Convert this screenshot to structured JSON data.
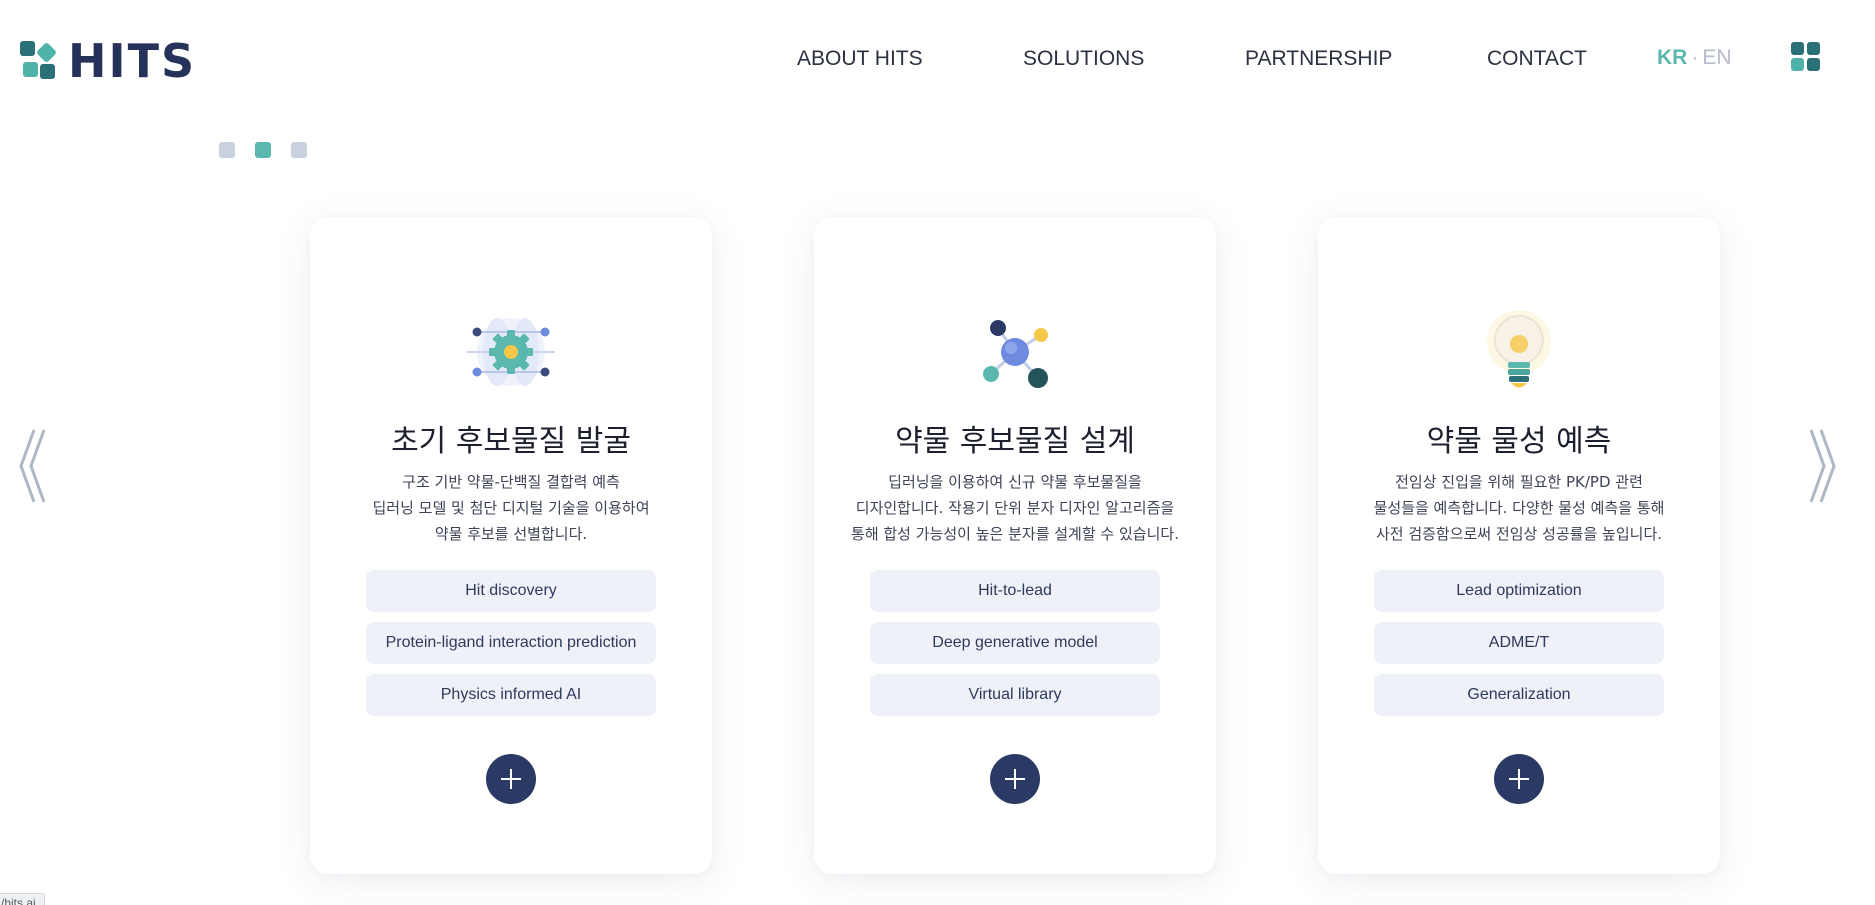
{
  "header": {
    "logo_text": "HITS",
    "nav": [
      {
        "label": "ABOUT HITS"
      },
      {
        "label": "SOLUTIONS"
      },
      {
        "label": "PARTNERSHIP"
      },
      {
        "label": "CONTACT"
      }
    ],
    "lang": {
      "kr": "KR",
      "separator": "·",
      "en": "EN",
      "active": "KR"
    },
    "menu_icon": "grid-menu-icon"
  },
  "carousel": {
    "pages": 3,
    "active_page": 2,
    "prev_icon": "chevron-double-left-icon",
    "next_icon": "chevron-double-right-icon"
  },
  "cards": [
    {
      "icon": "gear-network-icon",
      "title": "초기 후보물질 발굴",
      "desc": [
        "구조 기반 약물-단백질 결합력 예측",
        "딥러닝 모델 및 첨단 디지털 기술을 이용하여",
        "약물 후보를 선별합니다."
      ],
      "tags": [
        "Hit discovery",
        "Protein-ligand interaction prediction",
        "Physics informed AI"
      ]
    },
    {
      "icon": "molecule-icon",
      "title": "약물 후보물질 설계",
      "desc": [
        "딥러닝을 이용하여 신규 약물 후보물질을",
        "디자인합니다. 작용기 단위 분자 디자인 알고리즘을",
        "통해 합성 가능성이 높은 분자를 설계할 수 있습니다."
      ],
      "tags": [
        "Hit-to-lead",
        "Deep generative model",
        "Virtual library"
      ]
    },
    {
      "icon": "lightbulb-icon",
      "title": "약물 물성 예측",
      "desc": [
        "전임상 진입을 위해 필요한 PK/PD 관련",
        "물성들을 예측합니다. 다양한 물성 예측을 통해",
        "사전 검증함으로써 전임상 성공률을 높입니다."
      ],
      "tags": [
        "Lead optimization",
        "ADME/T",
        "Generalization"
      ]
    }
  ],
  "status_url": "/hits.ai",
  "colors": {
    "brand_navy": "#27325a",
    "brand_teal": "#5ab8ae",
    "button_navy": "#2b3a65",
    "tag_bg": "#eef1f8"
  }
}
